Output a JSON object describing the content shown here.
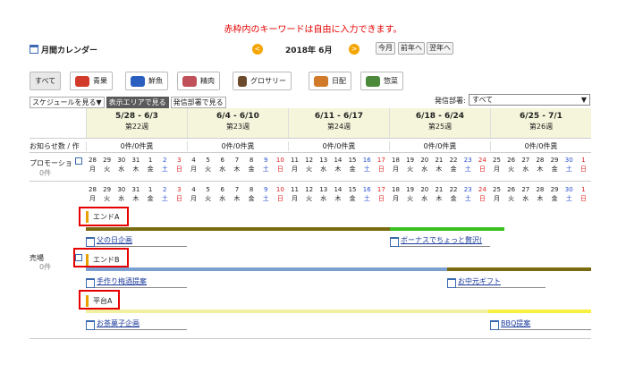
{
  "note": "赤枠内のキーワードは自由に入力できます。",
  "header": {
    "title": "月間カレンダー",
    "month": "2018年 6月",
    "prev": "<",
    "next": ">",
    "buttons": [
      "今月",
      "前年へ",
      "翌年へ"
    ]
  },
  "categories": [
    {
      "label": "すべて",
      "color": ""
    },
    {
      "label": "青果",
      "color": "#d23a2a"
    },
    {
      "label": "鮮魚",
      "color": "#2a5fc0"
    },
    {
      "label": "精肉",
      "color": "#c0505a"
    },
    {
      "label": "グロサリー",
      "color": "#6a4a2a"
    },
    {
      "label": "日配",
      "color": "#d07a2a"
    },
    {
      "label": "惣菜",
      "color": "#4a8a3a"
    }
  ],
  "toolbar": {
    "schedule": "スケジュールを見る▼",
    "area": "表示エリアで見る",
    "dept_view": "発信部署で見る",
    "dept_label": "発信部署:",
    "dept_value": "すべて"
  },
  "weeks": [
    {
      "range": "5/28 - 6/3",
      "week": "第22週",
      "news": "0件/0件異"
    },
    {
      "range": "6/4 - 6/10",
      "week": "第23週",
      "news": "0件/0件異"
    },
    {
      "range": "6/11 - 6/17",
      "week": "第24週",
      "news": "0件/0件異"
    },
    {
      "range": "6/18 - 6/24",
      "week": "第25週",
      "news": "0件/0件異"
    },
    {
      "range": "6/25 - 7/1",
      "week": "第26週",
      "news": "0件/0件異"
    }
  ],
  "rows": {
    "news_label": "お知らせ数 / 作",
    "promo_label": "プロモーショ",
    "promo_count": "0件",
    "store_label": "売場",
    "store_count": "0件"
  },
  "days": [
    "28",
    "29",
    "30",
    "31",
    "1",
    "2",
    "3",
    "4",
    "5",
    "6",
    "7",
    "8",
    "9",
    "10",
    "11",
    "12",
    "13",
    "14",
    "15",
    "16",
    "17",
    "18",
    "19",
    "20",
    "21",
    "22",
    "23",
    "24",
    "25",
    "26",
    "27",
    "28",
    "29",
    "30",
    "1"
  ],
  "weekdays": [
    "月",
    "火",
    "水",
    "木",
    "金",
    "土",
    "日"
  ],
  "keywords": [
    "エンドA",
    "エンドB",
    "平台A"
  ],
  "events": [
    "父の日企画",
    "ボーナスでちょっと贅沢(",
    "手作り梅酒提案",
    "お中元ギフト",
    "お茶菓子企画",
    "BBQ提案"
  ]
}
